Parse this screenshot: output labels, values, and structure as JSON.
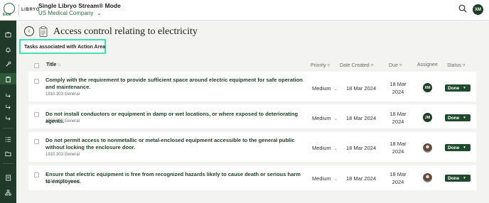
{
  "brand": {
    "mark": "ERM",
    "wordmark": "LIBRYO",
    "accent": "#2f6b45",
    "sidebar_color": "#1f3b27"
  },
  "header": {
    "mode_title": "Single Libryo Stream® Mode",
    "company": "US Medical Company",
    "user_initials": "XM"
  },
  "sidebar": {
    "icons": [
      "briefcase-icon",
      "bell-icon",
      "wrench-icon",
      "clipboard-icon",
      "arrow-right-icon",
      "arrow-right-icon",
      "arrow-right-icon",
      "list-icon",
      "folder-icon",
      "book-icon",
      "org-chart-icon"
    ],
    "active": "clipboard-icon"
  },
  "page": {
    "title": "Access control relating to electricity",
    "filter_chip": "Tasks associated with Action Area"
  },
  "table": {
    "columns": {
      "title": "Title",
      "priority": "Priority",
      "date_created": "Date Created",
      "due": "Due",
      "assignee": "Assignee",
      "status": "Status"
    },
    "rows": [
      {
        "title": "Comply with the requirement to provide sufficient space around electric equipment for safe operation and maintenance.",
        "reference": "1910.303 General",
        "priority": "Medium",
        "created": "18 Mar 2024",
        "due_day": "18 Mar",
        "due_year": "2024",
        "assignee": "XM",
        "status": "Done"
      },
      {
        "title": "Do not install conductors or equipment in damp or wet locations, or where exposed to deteriorating agents.",
        "reference": "1910.303 General",
        "priority": "Medium",
        "created": "18 Mar 2024",
        "due_day": "18 Mar",
        "due_year": "2024",
        "assignee": "JM",
        "status": "Done"
      },
      {
        "title": "Do not permit access to nonmetallic or metal-enclosed equipment accessible to the general public without locking the enclosure door.",
        "reference": "1910.303 General",
        "priority": "Medium",
        "created": "18 Mar 2024",
        "due_day": "18 Mar",
        "due_year": "2024",
        "assignee": "",
        "status": "Done"
      },
      {
        "title": "Ensure that electric equipment is free from recognized hazards likely to cause death or serious harm to employees.",
        "reference": "1910.303 General",
        "priority": "Medium",
        "created": "18 Mar 2024",
        "due_day": "18 Mar",
        "due_year": "2024",
        "assignee": "",
        "status": "Done"
      }
    ]
  }
}
